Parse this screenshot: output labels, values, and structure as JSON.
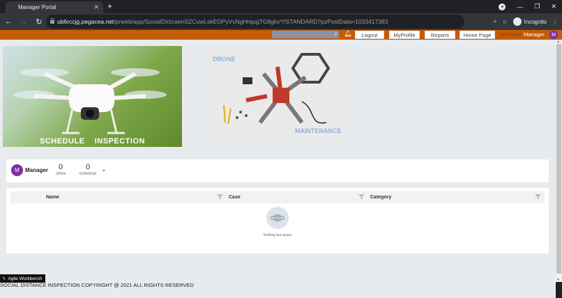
{
  "browser": {
    "tab_title": "Manager Portal",
    "url_host": "ub6rccjg.pegacea.net",
    "url_path": "/prweb/app/SocialDI/zcaenSZCuwLskEOPyVcNgHrqugTG8gkx*/!STANDARD?pzPostData=1033417383",
    "incognito_label": "Incognito"
  },
  "header": {
    "search_placeholder": "",
    "buttons": [
      "Logout",
      "MyProfile",
      "Reports",
      "Home Page"
    ],
    "welcome": "Welcome",
    "user": "Manager",
    "avatar_initial": "M",
    "bar_color": "#c45b07"
  },
  "banners": {
    "schedule_label": "SCHEDULE    INSPECTION",
    "maint_top": "DRONE",
    "maint_bottom": "MAINTENANCE"
  },
  "summary": {
    "avatar_initial": "M",
    "name": "Manager",
    "open_count": "0",
    "open_label": "OPEN",
    "overdue_count": "0",
    "overdue_label": "OVERDUE"
  },
  "grid": {
    "columns": [
      "Name",
      "Case",
      "Category"
    ],
    "empty_text": "Nothing but space"
  },
  "workbench_label": "Agile Workbench",
  "footer": "SOCIAL DISTANCE INSPECTION COPYRIGHT @ 2021 ALL RIGHTS RESERVED"
}
